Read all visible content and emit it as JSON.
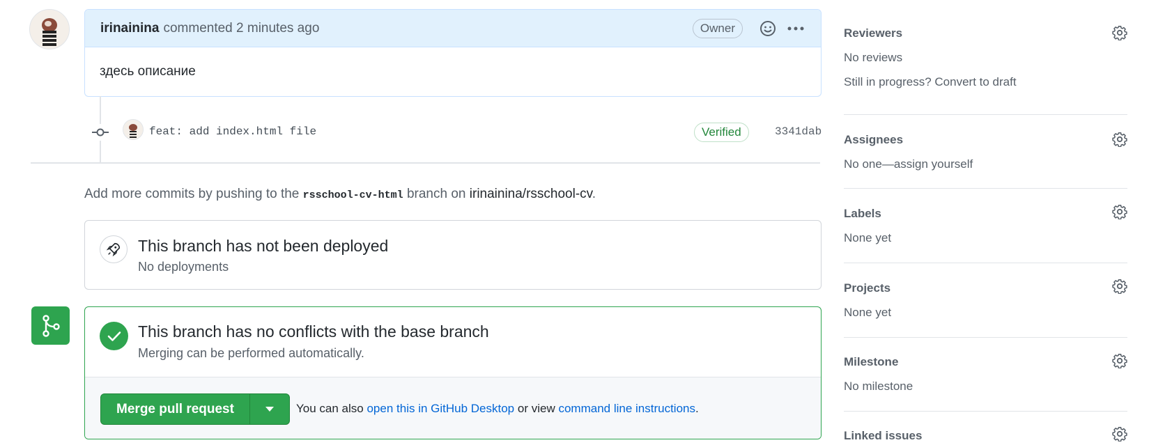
{
  "comment": {
    "author": "irinainina",
    "action": "commented",
    "time": "2 minutes ago",
    "badge": "Owner",
    "body": "здесь описание"
  },
  "commit": {
    "message": "feat: add index.html file",
    "verified_label": "Verified",
    "sha": "3341dab"
  },
  "push_hint": {
    "prefix": "Add more commits by pushing to the",
    "branch": "rsschool-cv-html",
    "middle": "branch on",
    "repo": "irinainina/rsschool-cv",
    "suffix": "."
  },
  "deployment": {
    "title": "This branch has not been deployed",
    "subtitle": "No deployments"
  },
  "merge": {
    "title": "This branch has no conflicts with the base branch",
    "subtitle": "Merging can be performed automatically.",
    "button_label": "Merge pull request",
    "hint_prefix": "You can also",
    "link_desktop": "open this in GitHub Desktop",
    "hint_middle": "or view",
    "link_cli": "command line instructions",
    "hint_suffix": "."
  },
  "sidebar": {
    "reviewers": {
      "title": "Reviewers",
      "value": "No reviews",
      "extra": "Still in progress? Convert to draft"
    },
    "assignees": {
      "title": "Assignees",
      "value": "No one—assign yourself"
    },
    "labels": {
      "title": "Labels",
      "value": "None yet"
    },
    "projects": {
      "title": "Projects",
      "value": "None yet"
    },
    "milestone": {
      "title": "Milestone",
      "value": "No milestone"
    },
    "linked_issues": {
      "title": "Linked issues"
    }
  },
  "colors": {
    "success": "#2ea44f",
    "link": "#0366d6",
    "header_bg": "#e1f1fd"
  },
  "icons": [
    "avatar",
    "smiley-icon",
    "kebab-icon",
    "commit-icon",
    "rocket-icon",
    "git-merge-icon",
    "check-icon",
    "triangle-down-icon",
    "gear-icon"
  ]
}
